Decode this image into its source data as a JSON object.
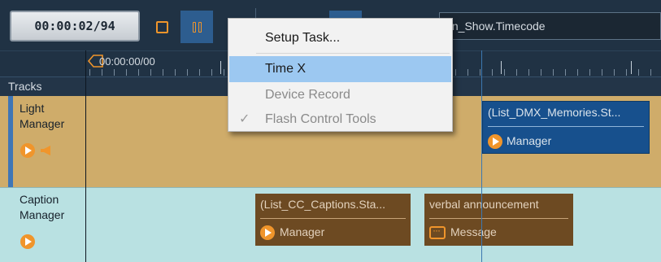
{
  "toolbar": {
    "timecode": "00:00:02/94",
    "show_field_text": "ain_Show.Timecode"
  },
  "ruler": {
    "start_time": "00:00:00/00"
  },
  "tracks_header": {
    "label": "Tracks"
  },
  "tracks": [
    {
      "name_line1": "Light",
      "name_line2": "Manager",
      "clips": [
        {
          "title": "(List_DMX_Memories.St...",
          "subtitle": "Manager"
        }
      ]
    },
    {
      "name_line1": "Caption",
      "name_line2": "Manager",
      "clips": [
        {
          "title": "(List_CC_Captions.Sta...",
          "subtitle": "Manager"
        },
        {
          "title": "verbal announcement",
          "subtitle": "Message"
        }
      ]
    }
  ],
  "context_menu": {
    "items": [
      {
        "label": "Setup Task...",
        "enabled": true
      },
      {
        "label": "Time X",
        "enabled": true,
        "highlighted": true
      },
      {
        "label": "Device Record",
        "enabled": false
      },
      {
        "label": "Flash Control Tools",
        "enabled": false,
        "checked": true
      }
    ]
  },
  "colors": {
    "accent_orange": "#f0952b",
    "light_track_bg": "#cfac6a",
    "caption_track_bg": "#b9e1e2",
    "menu_highlight": "#9cc8f1",
    "clip_blue": "#17508d",
    "clip_brown": "#6d4a22"
  }
}
